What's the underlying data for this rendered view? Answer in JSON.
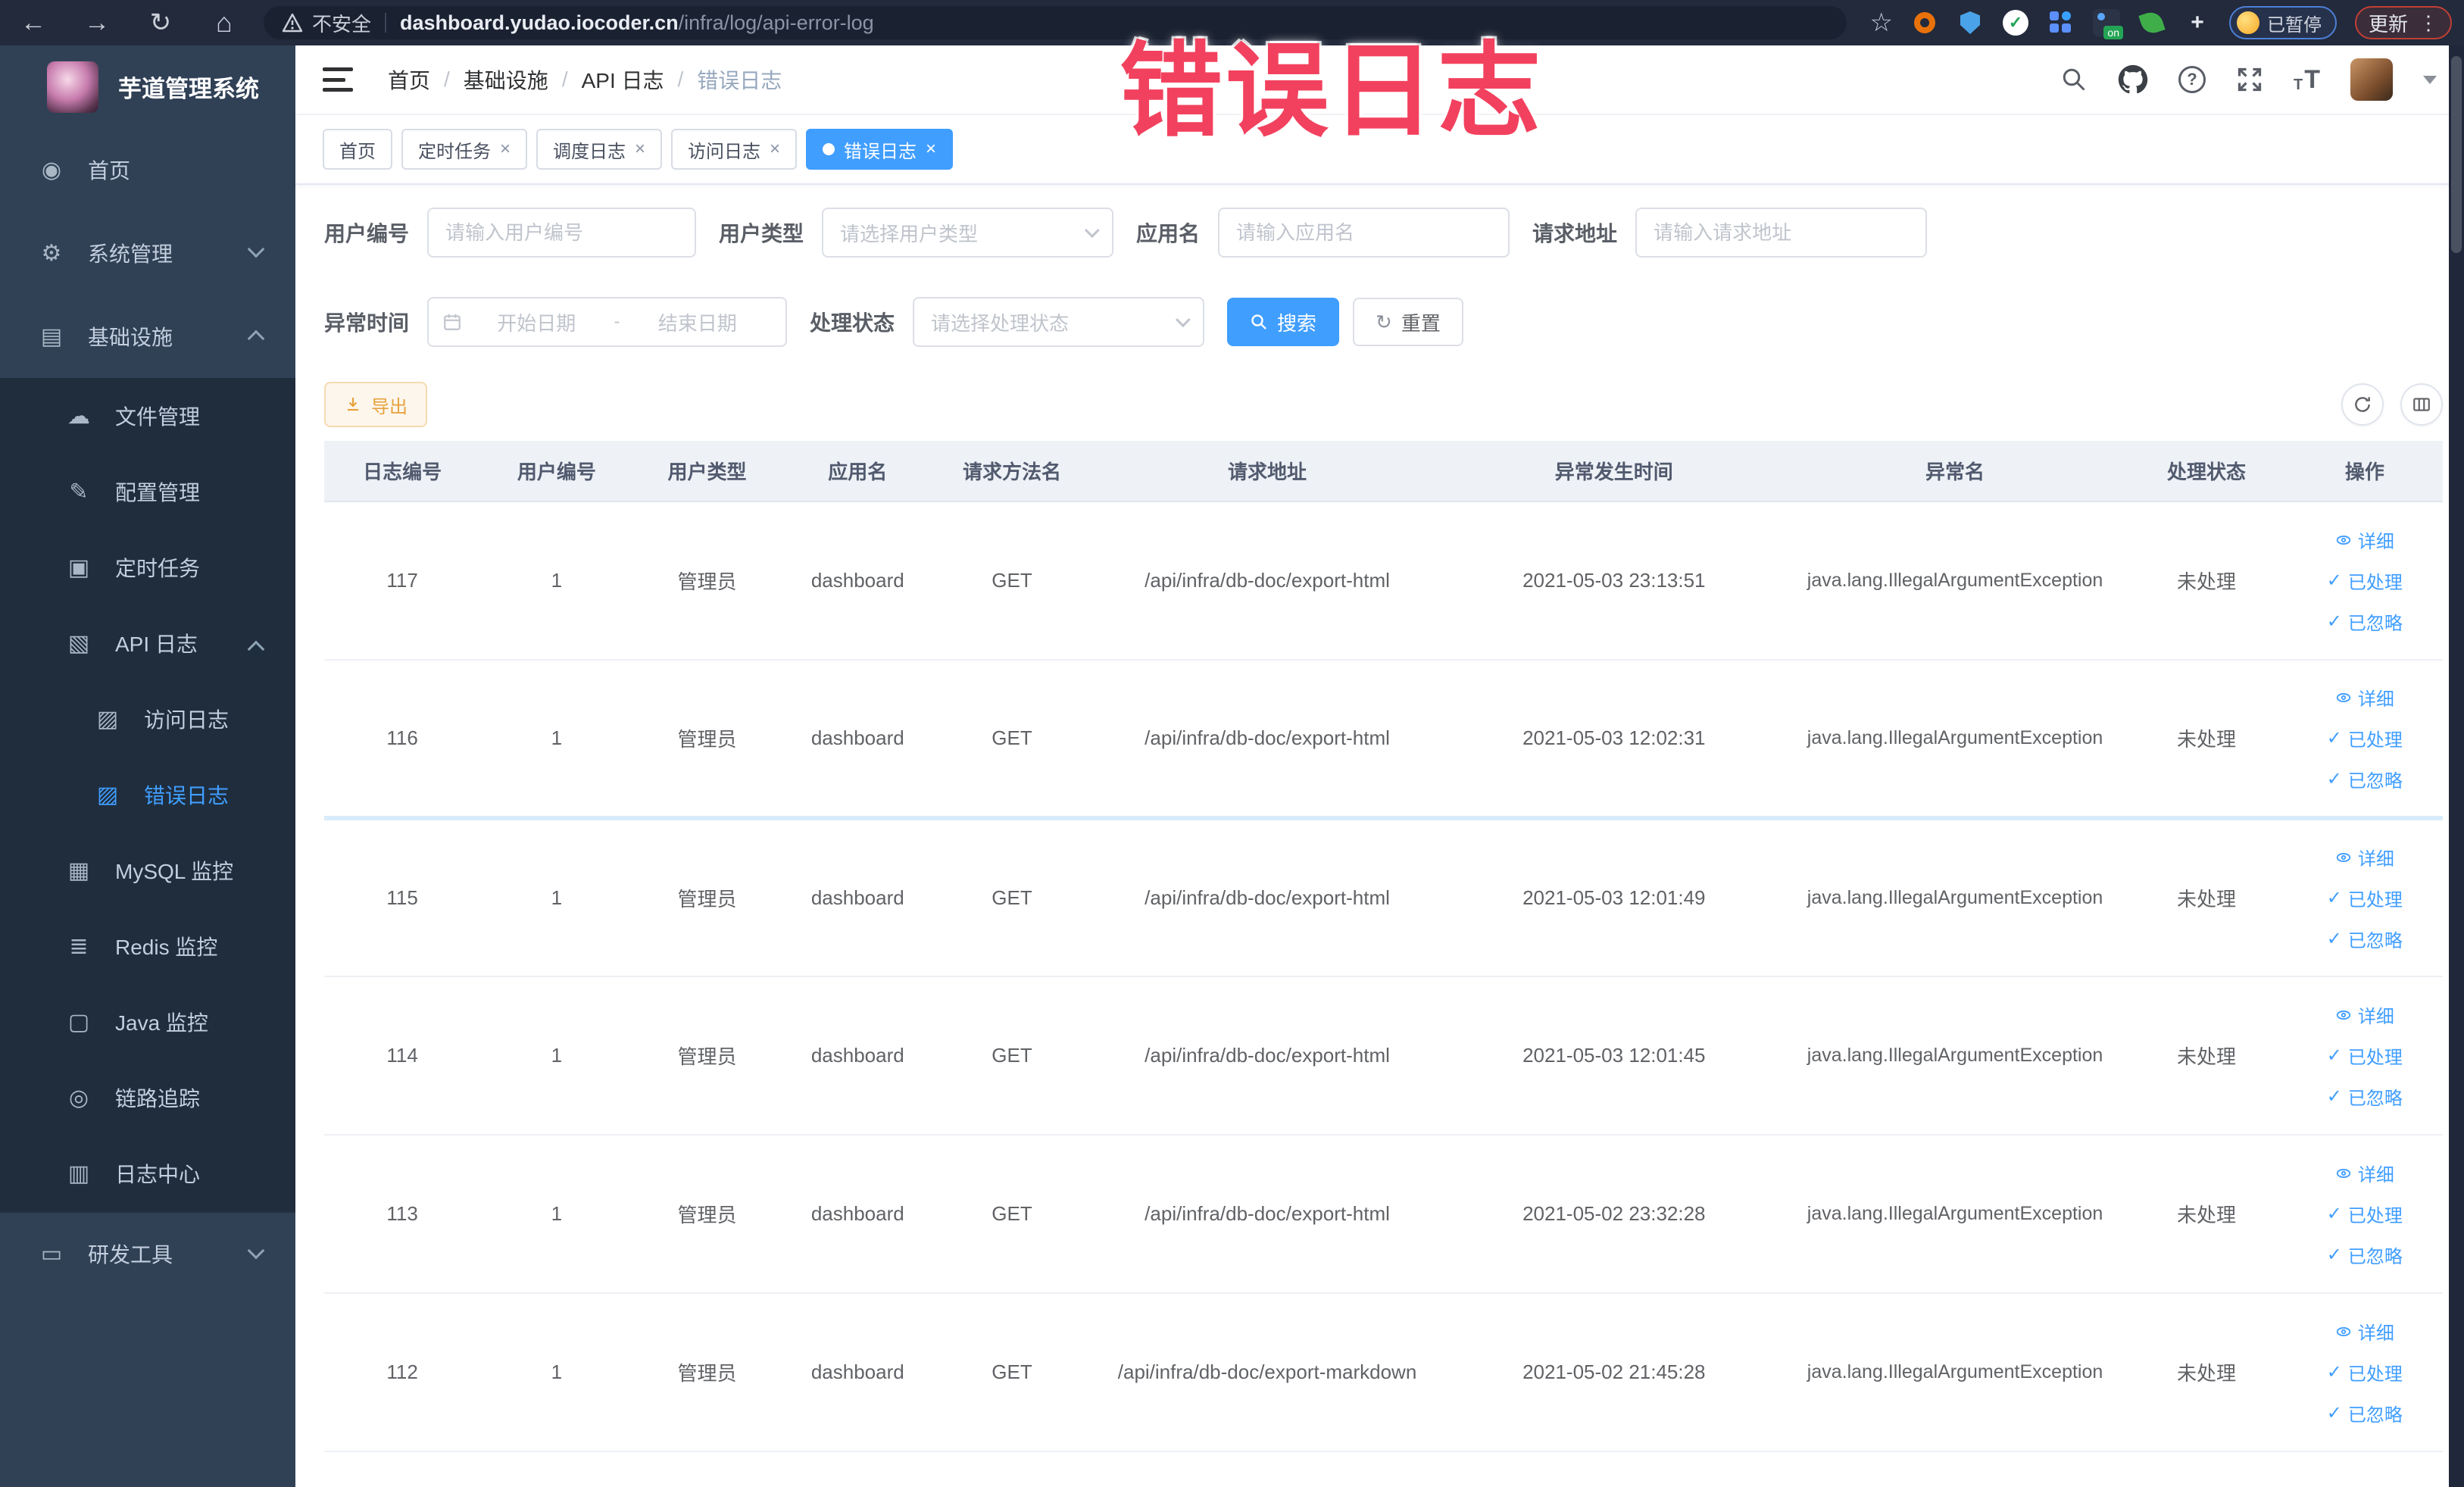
{
  "browser": {
    "security_label": "不安全",
    "url_host": "dashboard.yudao.iocoder.cn",
    "url_path": "/infra/log/api-error-log",
    "paused_badge": "已暂停",
    "update_label": "更新",
    "ext_on": "on"
  },
  "annotation": {
    "text": "错误日志",
    "color": "#f2415e"
  },
  "sidebar": {
    "title": "芋道管理系统",
    "items": [
      {
        "label": "首页"
      },
      {
        "label": "系统管理"
      },
      {
        "label": "基础设施"
      },
      {
        "label": "文件管理"
      },
      {
        "label": "配置管理"
      },
      {
        "label": "定时任务"
      },
      {
        "label": "API 日志"
      },
      {
        "label": "访问日志"
      },
      {
        "label": "错误日志"
      },
      {
        "label": "MySQL 监控"
      },
      {
        "label": "Redis 监控"
      },
      {
        "label": "Java 监控"
      },
      {
        "label": "链路追踪"
      },
      {
        "label": "日志中心"
      },
      {
        "label": "研发工具"
      }
    ]
  },
  "breadcrumb": {
    "items": [
      "首页",
      "基础设施",
      "API 日志",
      "错误日志"
    ]
  },
  "tabs": [
    {
      "label": "首页"
    },
    {
      "label": "定时任务"
    },
    {
      "label": "调度日志"
    },
    {
      "label": "访问日志"
    },
    {
      "label": "错误日志"
    }
  ],
  "filters": {
    "user_id_label": "用户编号",
    "user_id_placeholder": "请输入用户编号",
    "user_type_label": "用户类型",
    "user_type_placeholder": "请选择用户类型",
    "app_label": "应用名",
    "app_placeholder": "请输入应用名",
    "url_label": "请求地址",
    "url_placeholder": "请输入请求地址",
    "time_label": "异常时间",
    "time_start_placeholder": "开始日期",
    "time_separator": "-",
    "time_end_placeholder": "结束日期",
    "status_label": "处理状态",
    "status_placeholder": "请选择处理状态",
    "search_label": "搜索",
    "reset_label": "重置"
  },
  "toolbar": {
    "export_label": "导出"
  },
  "table": {
    "headers": [
      "日志编号",
      "用户编号",
      "用户类型",
      "应用名",
      "请求方法名",
      "请求地址",
      "异常发生时间",
      "异常名",
      "处理状态",
      "操作"
    ],
    "actions": {
      "detail": "详细",
      "processed": "已处理",
      "ignored": "已忽略"
    },
    "rows": [
      {
        "id": "117",
        "user_id": "1",
        "user_type": "管理员",
        "app": "dashboard",
        "method": "GET",
        "url": "/api/infra/db-doc/export-html",
        "time": "2021-05-03 23:13:51",
        "exception": "java.lang.IllegalArgumentException",
        "status": "未处理"
      },
      {
        "id": "116",
        "user_id": "1",
        "user_type": "管理员",
        "app": "dashboard",
        "method": "GET",
        "url": "/api/infra/db-doc/export-html",
        "time": "2021-05-03 12:02:31",
        "exception": "java.lang.IllegalArgumentException",
        "status": "未处理"
      },
      {
        "id": "115",
        "user_id": "1",
        "user_type": "管理员",
        "app": "dashboard",
        "method": "GET",
        "url": "/api/infra/db-doc/export-html",
        "time": "2021-05-03 12:01:49",
        "exception": "java.lang.IllegalArgumentException",
        "status": "未处理"
      },
      {
        "id": "114",
        "user_id": "1",
        "user_type": "管理员",
        "app": "dashboard",
        "method": "GET",
        "url": "/api/infra/db-doc/export-html",
        "time": "2021-05-03 12:01:45",
        "exception": "java.lang.IllegalArgumentException",
        "status": "未处理"
      },
      {
        "id": "113",
        "user_id": "1",
        "user_type": "管理员",
        "app": "dashboard",
        "method": "GET",
        "url": "/api/infra/db-doc/export-html",
        "time": "2021-05-02 23:32:28",
        "exception": "java.lang.IllegalArgumentException",
        "status": "未处理"
      },
      {
        "id": "112",
        "user_id": "1",
        "user_type": "管理员",
        "app": "dashboard",
        "method": "GET",
        "url": "/api/infra/db-doc/export-markdown",
        "time": "2021-05-02 21:45:28",
        "exception": "java.lang.IllegalArgumentException",
        "status": "未处理"
      }
    ]
  },
  "colors": {
    "accent": "#409eff",
    "warning": "#e6a23c",
    "sidebar_bg": "#304156",
    "submenu_bg": "#1f2d3d"
  }
}
